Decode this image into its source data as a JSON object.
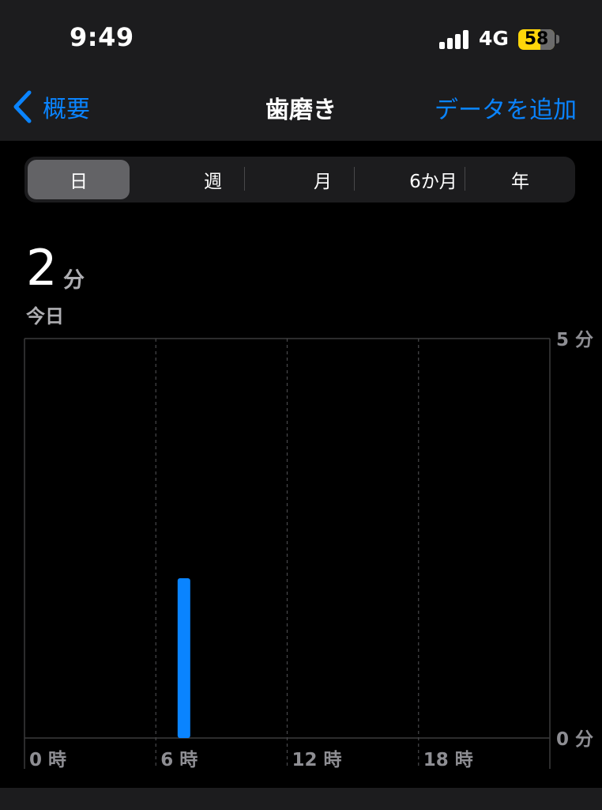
{
  "status_bar": {
    "time": "9:49",
    "network": "4G",
    "battery": "58",
    "battery_color": "#ffd60a"
  },
  "nav": {
    "back_label": "概要",
    "title": "歯磨き",
    "add_label": "データを追加",
    "accent_color": "#0a84ff"
  },
  "segments": {
    "day": "日",
    "week": "週",
    "month": "月",
    "six_months": "6か月",
    "year": "年",
    "selected": "日"
  },
  "summary": {
    "value": "2",
    "unit": "分",
    "date_label": "今日"
  },
  "chart_data": {
    "type": "bar",
    "x_axis": {
      "ticks": [
        "0 時",
        "6 時",
        "12 時",
        "18 時"
      ],
      "range": [
        0,
        24
      ],
      "unit": "hour"
    },
    "y_axis": {
      "ticks": [
        {
          "value": 5,
          "label": "5 分"
        },
        {
          "value": 0,
          "label": "0 分"
        }
      ],
      "range": [
        0,
        5
      ]
    },
    "bars": [
      {
        "hour": 7,
        "value": 2
      }
    ],
    "color": "#0a84ff",
    "grid": true
  }
}
